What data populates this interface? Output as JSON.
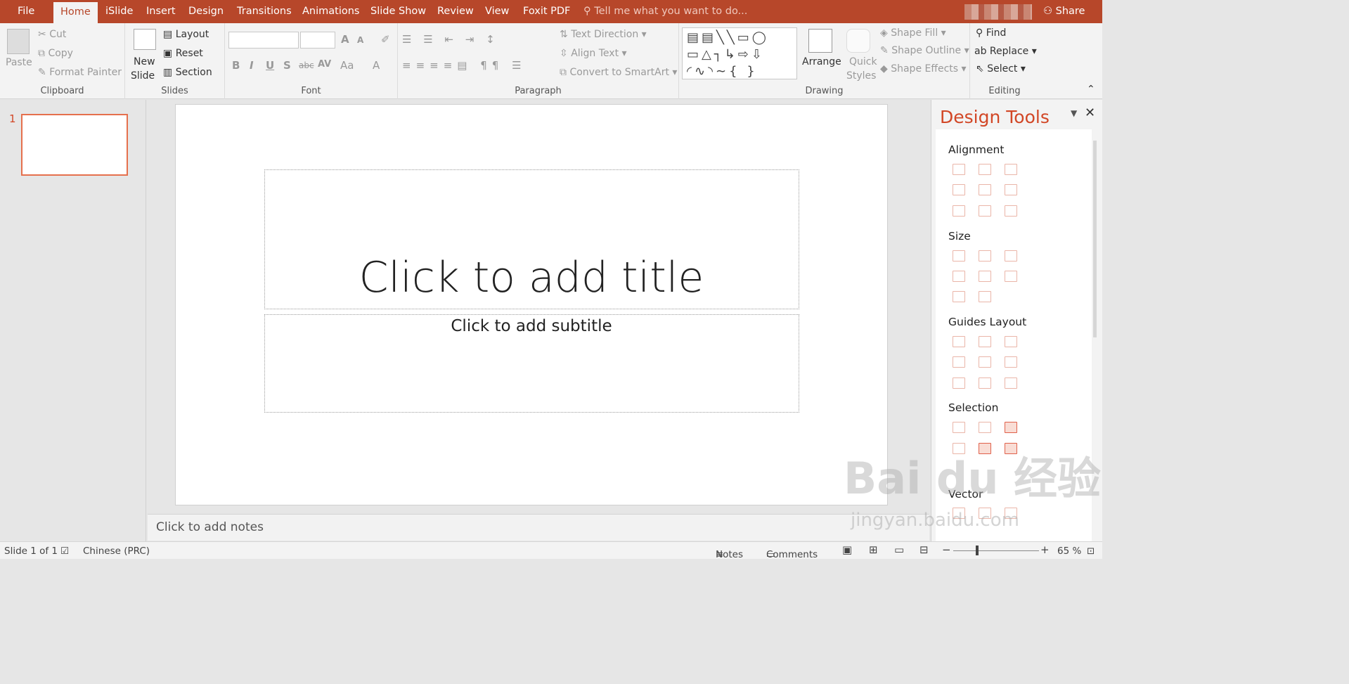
{
  "tabs": [
    "File",
    "Home",
    "iSlide",
    "Insert",
    "Design",
    "Transitions",
    "Animations",
    "Slide Show",
    "Review",
    "View",
    "Foxit PDF"
  ],
  "tell_me": "Tell me what you want to do...",
  "share": "Share",
  "clipboard": {
    "paste": "Paste",
    "cut": "Cut",
    "copy": "Copy",
    "format_painter": "Format Painter",
    "label": "Clipboard"
  },
  "slides_group": {
    "new_slide": "New",
    "new_slide2": "Slide",
    "layout": "Layout",
    "reset": "Reset",
    "section": "Section",
    "label": "Slides"
  },
  "font_group": {
    "label": "Font",
    "bold": "B",
    "italic": "I",
    "underline": "U",
    "shadow": "S",
    "strike": "abc",
    "spacing": "AV",
    "case": "Aa",
    "color": "A"
  },
  "paragraph_group": {
    "text_direction": "Text Direction",
    "align_text": "Align Text",
    "convert": "Convert to SmartArt",
    "label": "Paragraph"
  },
  "drawing_group": {
    "arrange": "Arrange",
    "quick": "Quick",
    "styles": "Styles",
    "fill": "Shape Fill",
    "outline": "Shape Outline",
    "effects": "Shape Effects",
    "label": "Drawing"
  },
  "editing_group": {
    "find": "Find",
    "replace": "Replace",
    "select": "Select",
    "label": "Editing"
  },
  "thumbnail": {
    "number": "1"
  },
  "slide": {
    "title": "Click to add title",
    "subtitle": "Click to add subtitle"
  },
  "notes_placeholder": "Click to add notes",
  "design_tools": {
    "title": "Design Tools",
    "sections": [
      "Alignment",
      "Size",
      "Guides Layout",
      "Selection",
      "Vector"
    ]
  },
  "status": {
    "slide": "Slide 1 of 1",
    "language": "Chinese (PRC)",
    "notes": "Notes",
    "comments": "Comments",
    "zoom": "65 %"
  },
  "watermark": {
    "brand": "Bai du 经验",
    "url": "jingyan.baidu.com"
  },
  "colors": {
    "accent": "#b7472a",
    "accent_text": "#d24726"
  }
}
